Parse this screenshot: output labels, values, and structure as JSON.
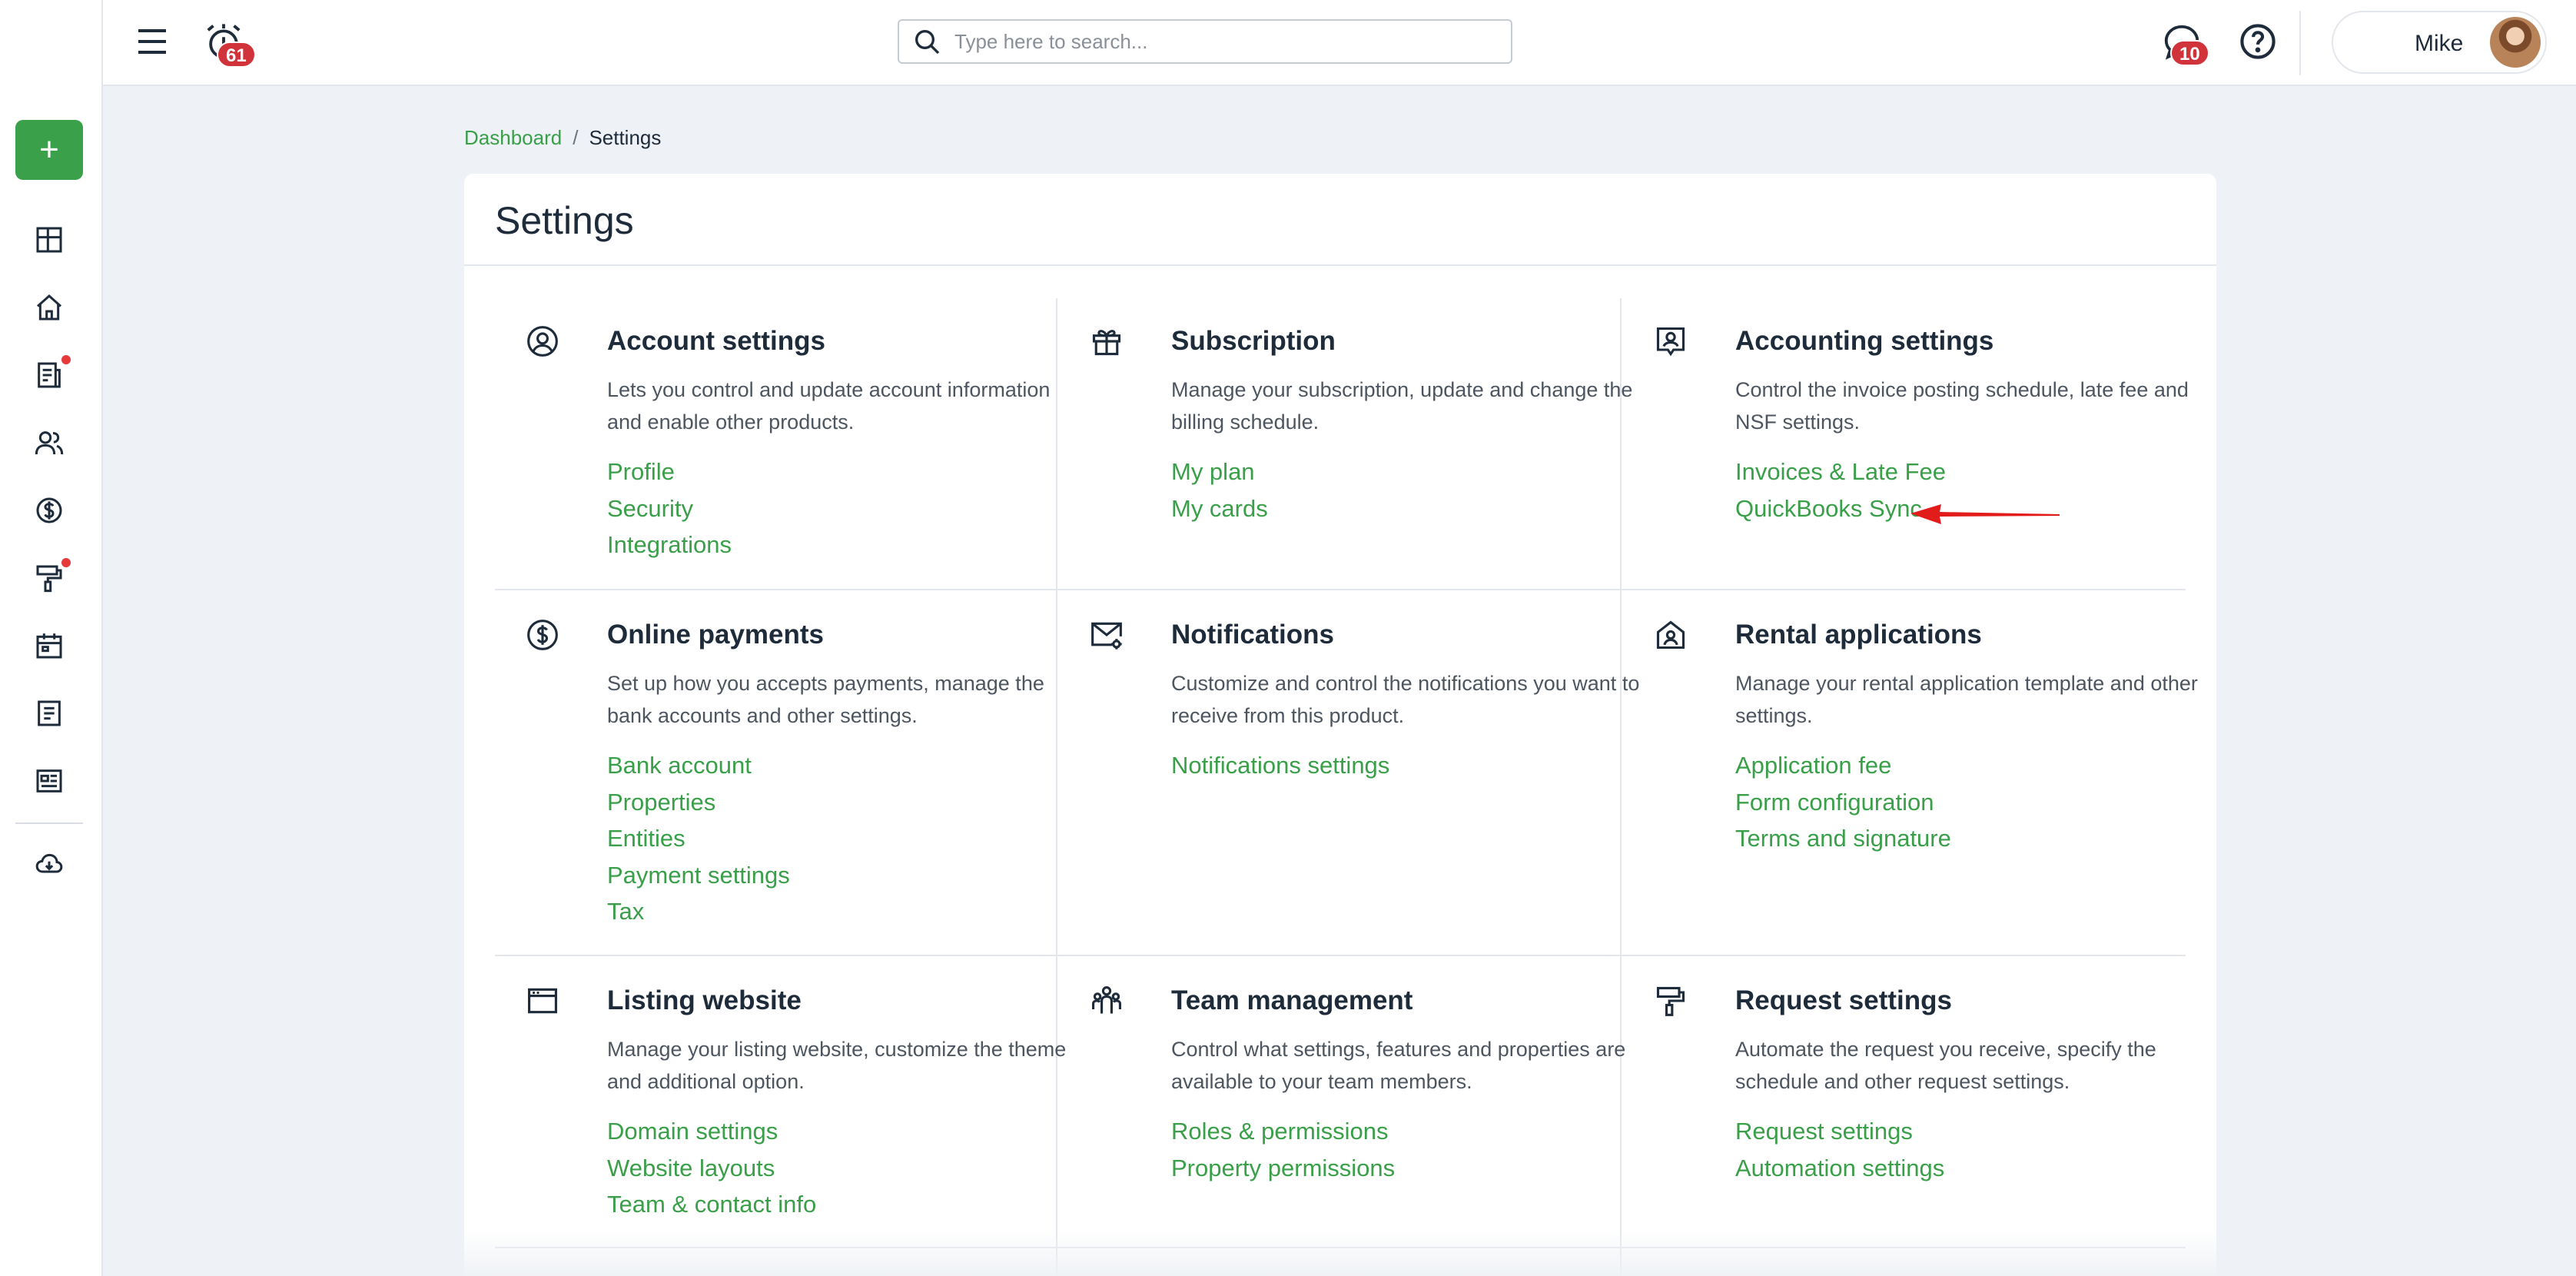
{
  "header": {
    "alarm_count": "61",
    "search_placeholder": "Type here to search...",
    "messages_count": "10",
    "user_name": "Mike"
  },
  "sidebar": {
    "add_label": "+",
    "items": [
      {
        "icon": "dashboard-grid-icon"
      },
      {
        "icon": "home-icon"
      },
      {
        "icon": "documents-icon",
        "has_dot": true
      },
      {
        "icon": "people-icon"
      },
      {
        "icon": "dollar-icon"
      },
      {
        "icon": "paint-roller-icon",
        "has_dot": true
      },
      {
        "icon": "calendar-icon"
      },
      {
        "icon": "notes-icon"
      },
      {
        "icon": "listing-card-icon"
      },
      {
        "icon": "cloud-download-icon"
      }
    ]
  },
  "breadcrumb": {
    "home": "Dashboard",
    "separator": "/",
    "current": "Settings"
  },
  "page": {
    "title": "Settings",
    "accent_color": "#3a9f49"
  },
  "sections": [
    {
      "title": "Account settings",
      "icon": "user-circle-icon",
      "description": "Lets you control and update account information and enable other products.",
      "links": [
        "Profile",
        "Security",
        "Integrations"
      ]
    },
    {
      "title": "Subscription",
      "icon": "gift-icon",
      "description": "Manage your subscription, update and change the billing schedule.",
      "links": [
        "My plan",
        "My cards"
      ]
    },
    {
      "title": "Accounting settings",
      "icon": "accounting-icon",
      "description": "Control the invoice posting schedule, late fee and NSF settings.",
      "links": [
        "Invoices & Late Fee",
        "QuickBooks Sync"
      ]
    },
    {
      "title": "Online payments",
      "icon": "dollar-circle-icon",
      "description": "Set up how you accepts payments, manage the bank accounts and other settings.",
      "links": [
        "Bank account",
        "Properties",
        "Entities",
        "Payment settings",
        "Tax"
      ]
    },
    {
      "title": "Notifications",
      "icon": "mail-gear-icon",
      "description": "Customize and control the notifications you want to receive from this product.",
      "links": [
        "Notifications settings"
      ]
    },
    {
      "title": "Rental applications",
      "icon": "house-user-icon",
      "description": "Manage your rental application template and other settings.",
      "links": [
        "Application fee",
        "Form configuration",
        "Terms and signature"
      ]
    },
    {
      "title": "Listing website",
      "icon": "browser-window-icon",
      "description": "Manage your listing website, customize the theme and additional option.",
      "links": [
        "Domain settings",
        "Website layouts",
        "Team & contact info"
      ]
    },
    {
      "title": "Team management",
      "icon": "team-icon",
      "description": "Control what settings, features and properties are available to your team members.",
      "links": [
        "Roles & permissions",
        "Property permissions"
      ]
    },
    {
      "title": "Request settings",
      "icon": "paint-roller-icon",
      "description": "Automate the request you receive, specify the schedule and other request settings.",
      "links": [
        "Request settings",
        "Automation settings"
      ]
    }
  ],
  "annotation": {
    "icon": "red-arrow-icon",
    "color": "#e21b1b"
  }
}
